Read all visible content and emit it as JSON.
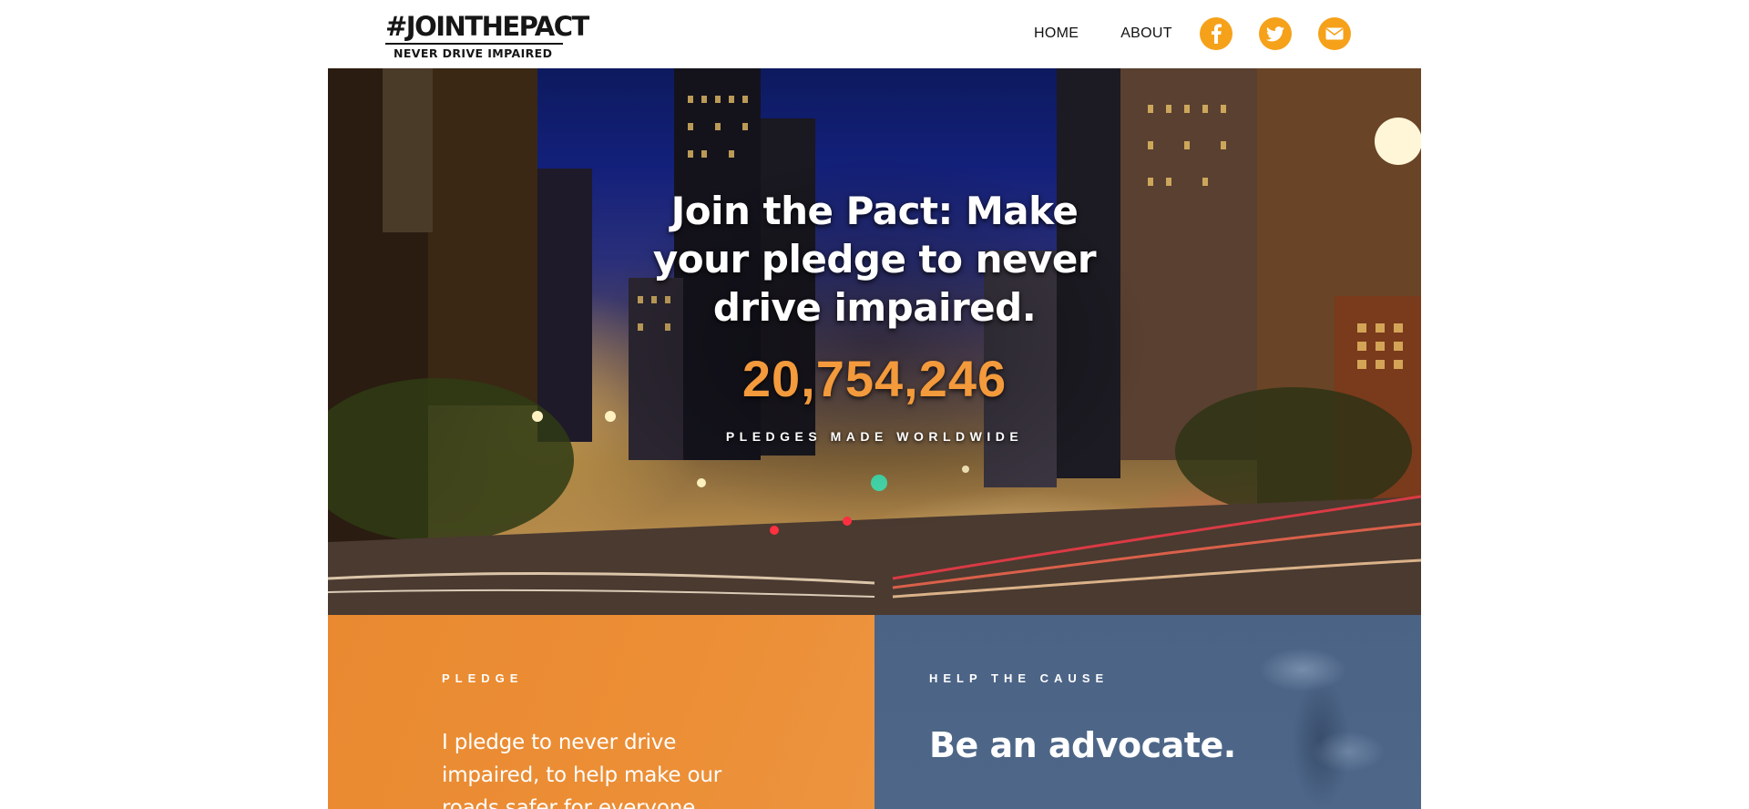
{
  "header": {
    "logo_mark": "#JOINTHEPACT",
    "logo_tagline": "NEVER DRIVE IMPAIRED",
    "nav": [
      {
        "label": "HOME"
      },
      {
        "label": "ABOUT"
      }
    ],
    "social": [
      {
        "icon": "facebook-icon",
        "glyph": "f"
      },
      {
        "icon": "twitter-icon"
      },
      {
        "icon": "mail-icon"
      }
    ]
  },
  "hero": {
    "title": "Join the Pact: Make your pledge to never drive impaired.",
    "pledge_count": "20,754,246",
    "pledge_caption": "PLEDGES MADE WORLDWIDE"
  },
  "panels": {
    "pledge": {
      "kicker": "PLEDGE",
      "body": "I pledge to never drive impaired, to help make our roads safer for everyone."
    },
    "advocate": {
      "kicker": "HELP THE CAUSE",
      "headline": "Be an advocate."
    }
  },
  "colors": {
    "accent_orange": "#f6a11a",
    "pledge_count": "#f39a3c",
    "pledge_panel": "#e98a31",
    "advocate_panel": "#4b6385"
  }
}
